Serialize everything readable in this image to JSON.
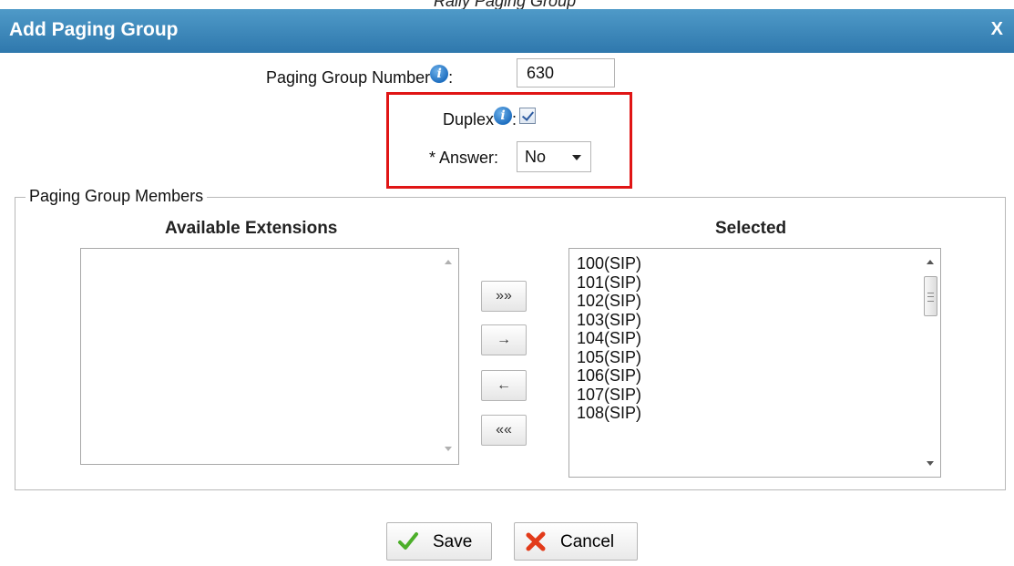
{
  "caption_fragment": "Rally Paging Group",
  "dialog": {
    "title": "Add Paging Group",
    "close_label": "X"
  },
  "form": {
    "number_label": "Paging Group Number",
    "number_value": "630",
    "duplex_label": "Duplex",
    "duplex_checked": true,
    "answer_label": "* Answer:",
    "answer_value": "No",
    "colon": ":",
    "info_glyph": "i"
  },
  "members": {
    "legend": "Paging Group Members",
    "available_header": "Available Extensions",
    "selected_header": "Selected",
    "available_items": [],
    "selected_items": [
      "100(SIP)",
      "101(SIP)",
      "102(SIP)",
      "103(SIP)",
      "104(SIP)",
      "105(SIP)",
      "106(SIP)",
      "107(SIP)",
      "108(SIP)"
    ]
  },
  "move_buttons": {
    "add_all": "»»",
    "add_one": "→",
    "remove_one": "←",
    "remove_all": "««"
  },
  "buttons": {
    "save": "Save",
    "cancel": "Cancel"
  },
  "icons": {
    "info": "info-icon",
    "save": "checkmark-icon",
    "cancel": "x-cross-icon"
  },
  "colors": {
    "titlebar": "#3a86bb",
    "highlight": "#e01515",
    "info_icon": "#1f6fc0",
    "save_check": "#4caf2a",
    "cancel_x": "#e23b1a"
  }
}
